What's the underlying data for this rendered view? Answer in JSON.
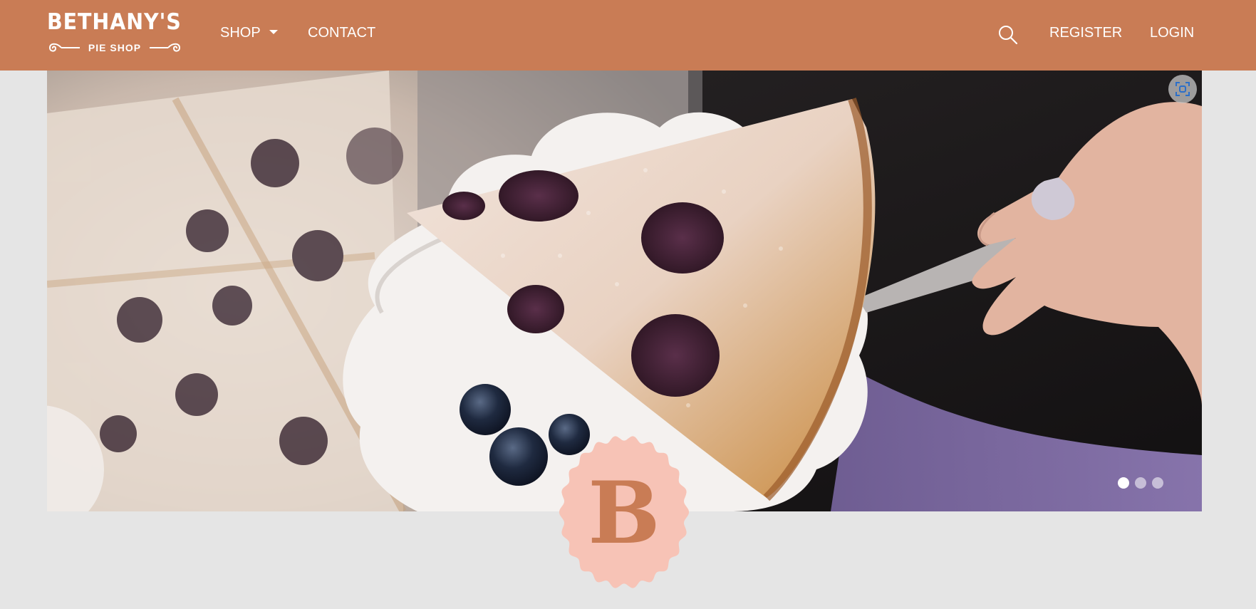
{
  "brand": {
    "name": "BETHANY'S",
    "subtitle": "PIE SHOP",
    "badge_letter": "B"
  },
  "nav": {
    "shop": "SHOP",
    "contact": "CONTACT",
    "register": "REGISTER",
    "login": "LOGIN"
  },
  "icons": {
    "search": "search-icon",
    "expand": "focus-expand-icon",
    "caret": "caret-down-icon"
  },
  "hero": {
    "image": "blueberry pie slice on server",
    "slides_total": 3,
    "active_slide": 1
  },
  "colors": {
    "navbar": "#c97c55",
    "page_background": "#e5e5e5",
    "badge_fill": "#f7c3b6",
    "badge_letter": "#c97c55"
  }
}
